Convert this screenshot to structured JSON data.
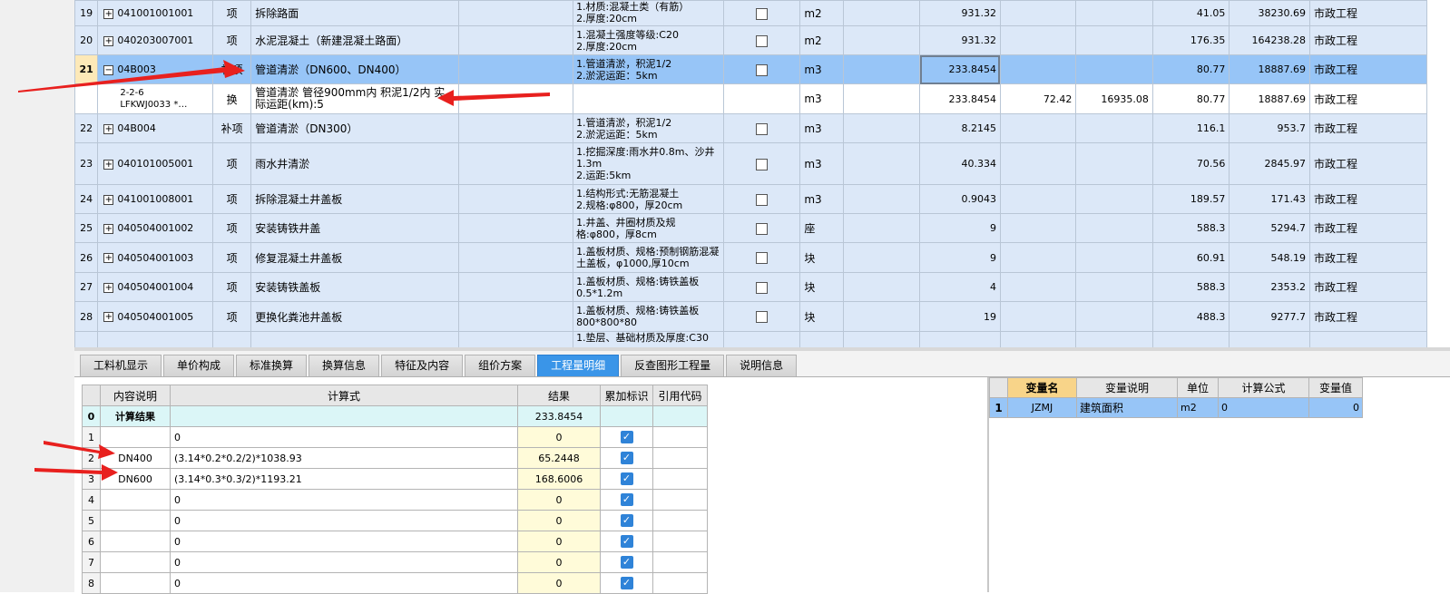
{
  "bill": {
    "rows": [
      {
        "no": "19",
        "code": "041001001001",
        "type": "项",
        "name": "拆除路面",
        "feature": "1.材质:混凝土类（有筋）\n2.厚度:20cm",
        "unit": "m2",
        "qty": "931.32",
        "price": "",
        "sum": "",
        "cprice": "41.05",
        "ctotal": "38230.69",
        "prof": "市政工程"
      },
      {
        "no": "20",
        "code": "040203007001",
        "type": "项",
        "name": "水泥混凝土（新建混凝土路面）",
        "feature": "1.混凝土强度等级:C20\n2.厚度:20cm",
        "unit": "m2",
        "qty": "931.32",
        "price": "",
        "sum": "",
        "cprice": "176.35",
        "ctotal": "164238.28",
        "prof": "市政工程"
      },
      {
        "no": "21",
        "code": "04B003",
        "type": "补项",
        "name": "管道清淤（DN600、DN400）",
        "feature": "1.管道清淤，积泥1/2\n2.淤泥运距：5km",
        "unit": "m3",
        "qty": "233.8454",
        "price": "",
        "sum": "",
        "cprice": "80.77",
        "ctotal": "18887.69",
        "prof": "市政工程"
      },
      {
        "no": "",
        "code": "2-2-6\nLFKWJ0033 *…",
        "type": "换",
        "name": "管道清淤 管径900mm内 积泥1/2内  实际运距(km):5",
        "feature": "",
        "unit": "m3",
        "qty": "233.8454",
        "price": "72.42",
        "sum": "16935.08",
        "cprice": "80.77",
        "ctotal": "18887.69",
        "prof": "市政工程"
      },
      {
        "no": "22",
        "code": "04B004",
        "type": "补项",
        "name": "管道清淤（DN300）",
        "feature": "1.管道清淤，积泥1/2\n2.淤泥运距：5km",
        "unit": "m3",
        "qty": "8.2145",
        "price": "",
        "sum": "",
        "cprice": "116.1",
        "ctotal": "953.7",
        "prof": "市政工程"
      },
      {
        "no": "23",
        "code": "040101005001",
        "type": "项",
        "name": "雨水井清淤",
        "feature": "1.挖掘深度:雨水井0.8m、沙井1.3m\n2.运距:5km",
        "unit": "m3",
        "qty": "40.334",
        "price": "",
        "sum": "",
        "cprice": "70.56",
        "ctotal": "2845.97",
        "prof": "市政工程"
      },
      {
        "no": "24",
        "code": "041001008001",
        "type": "项",
        "name": "拆除混凝土井盖板",
        "feature": "1.结构形式:无筋混凝土\n2.规格:φ800，厚20cm",
        "unit": "m3",
        "qty": "0.9043",
        "price": "",
        "sum": "",
        "cprice": "189.57",
        "ctotal": "171.43",
        "prof": "市政工程"
      },
      {
        "no": "25",
        "code": "040504001002",
        "type": "项",
        "name": "安装铸铁井盖",
        "feature": "1.井盖、井圈材质及规格:φ800，厚8cm",
        "unit": "座",
        "qty": "9",
        "price": "",
        "sum": "",
        "cprice": "588.3",
        "ctotal": "5294.7",
        "prof": "市政工程"
      },
      {
        "no": "26",
        "code": "040504001003",
        "type": "项",
        "name": "修复混凝土井盖板",
        "feature": "1.盖板材质、规格:预制钢筋混凝土盖板，φ1000,厚10cm",
        "unit": "块",
        "qty": "9",
        "price": "",
        "sum": "",
        "cprice": "60.91",
        "ctotal": "548.19",
        "prof": "市政工程"
      },
      {
        "no": "27",
        "code": "040504001004",
        "type": "项",
        "name": "安装铸铁盖板",
        "feature": "1.盖板材质、规格:铸铁盖板0.5*1.2m",
        "unit": "块",
        "qty": "4",
        "price": "",
        "sum": "",
        "cprice": "588.3",
        "ctotal": "2353.2",
        "prof": "市政工程"
      },
      {
        "no": "28",
        "code": "040504001005",
        "type": "项",
        "name": "更换化粪池井盖板",
        "feature": "1.盖板材质、规格:铸铁盖板800*800*80",
        "unit": "块",
        "qty": "19",
        "price": "",
        "sum": "",
        "cprice": "488.3",
        "ctotal": "9277.7",
        "prof": "市政工程"
      },
      {
        "no": "",
        "code": "",
        "type": "",
        "name": "",
        "feature": "1.垫层、基础材质及厚度:C30",
        "unit": "",
        "qty": "",
        "price": "",
        "sum": "",
        "cprice": "",
        "ctotal": "",
        "prof": ""
      }
    ]
  },
  "tabs": [
    "工料机显示",
    "单价构成",
    "标准换算",
    "换算信息",
    "特征及内容",
    "组价方案",
    "工程量明细",
    "反查图形工程量",
    "说明信息"
  ],
  "calc": {
    "headers": [
      "内容说明",
      "计算式",
      "结果",
      "累加标识",
      "引用代码"
    ],
    "rows": [
      {
        "no": "0",
        "desc": "计算结果",
        "formula": "",
        "result": "233.8454"
      },
      {
        "no": "1",
        "desc": "",
        "formula": "0",
        "result": "0"
      },
      {
        "no": "2",
        "desc": "DN400",
        "formula": "(3.14*0.2*0.2/2)*1038.93",
        "result": "65.2448"
      },
      {
        "no": "3",
        "desc": "DN600",
        "formula": "(3.14*0.3*0.3/2)*1193.21",
        "result": "168.6006"
      },
      {
        "no": "4",
        "desc": "",
        "formula": "0",
        "result": "0"
      },
      {
        "no": "5",
        "desc": "",
        "formula": "0",
        "result": "0"
      },
      {
        "no": "6",
        "desc": "",
        "formula": "0",
        "result": "0"
      },
      {
        "no": "7",
        "desc": "",
        "formula": "0",
        "result": "0"
      },
      {
        "no": "8",
        "desc": "",
        "formula": "0",
        "result": "0"
      }
    ]
  },
  "vars": {
    "headers": [
      "变量名",
      "变量说明",
      "单位",
      "计算公式",
      "变量值"
    ],
    "rows": [
      {
        "no": "1",
        "name": "JZMJ",
        "desc": "建筑面积",
        "unit": "m2",
        "formula": "0",
        "value": "0"
      }
    ]
  },
  "colors": {
    "selected_row": "#97c5f7",
    "main_row": "#dce8f8",
    "active_tab": "#3a95e8",
    "arrow": "#e8201e"
  }
}
